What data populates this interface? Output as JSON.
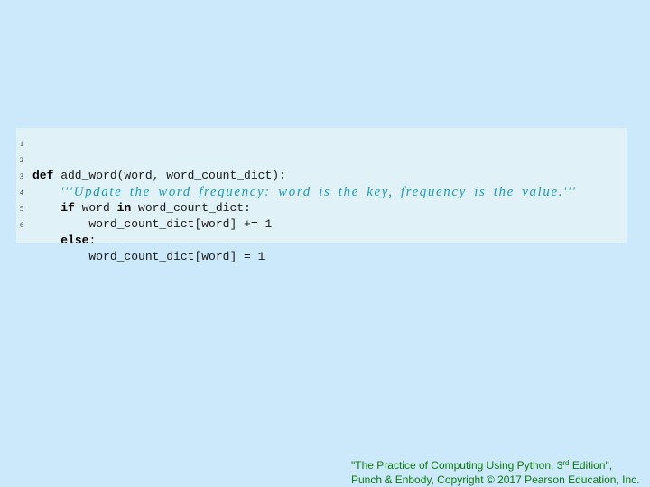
{
  "code": {
    "lines": [
      {
        "num": "1",
        "indent": "",
        "kw1": "def",
        "text1": " add_word(word, word_count_dict):",
        "kw2": "",
        "text2": ""
      },
      {
        "num": "2",
        "indent": "    ",
        "docstring": "'''Update the word frequency: word is the key, frequency is the value.'''"
      },
      {
        "num": "3",
        "indent": "    ",
        "kw1": "if",
        "text1": " word ",
        "kw2": "in",
        "text2": " word_count_dict:"
      },
      {
        "num": "4",
        "indent": "        ",
        "kw1": "",
        "text1": "word_count_dict[word] += 1",
        "kw2": "",
        "text2": ""
      },
      {
        "num": "5",
        "indent": "    ",
        "kw1": "else",
        "text1": ":",
        "kw2": "",
        "text2": ""
      },
      {
        "num": "6",
        "indent": "        ",
        "kw1": "",
        "text1": "word_count_dict[word] = 1",
        "kw2": "",
        "text2": ""
      }
    ]
  },
  "footer": {
    "line1_pre": "\"The Practice of Computing Using Python, 3",
    "line1_sup": "rd",
    "line1_post": " Edition\",",
    "line2": "Punch & Enbody, Copyright © 2017 Pearson Education, Inc."
  }
}
